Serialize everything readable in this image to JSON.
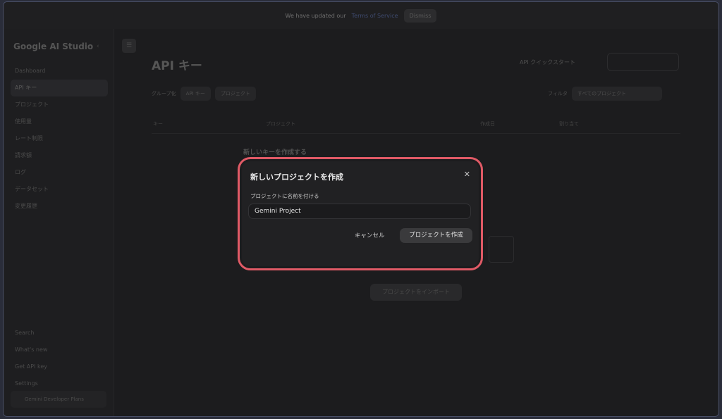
{
  "banner": {
    "text": "We have updated our",
    "link": "Terms of Service",
    "button": "Dismiss"
  },
  "sidebar": {
    "logo": "Google AI Studio",
    "items": [
      {
        "label": "Dashboard"
      },
      {
        "label": "API キー"
      },
      {
        "label": "プロジェクト"
      },
      {
        "label": "使用量"
      },
      {
        "label": "レート制限"
      },
      {
        "label": "請求額"
      },
      {
        "label": "ログ"
      },
      {
        "label": "データセット"
      },
      {
        "label": "変更履歴"
      }
    ],
    "bottom_items": [
      {
        "label": "Search"
      },
      {
        "label": "What's new"
      },
      {
        "label": "Get API key"
      },
      {
        "label": "Settings"
      }
    ],
    "account": "Gemini Developer Plans"
  },
  "main": {
    "title": "API キー",
    "quickstart": "API クイックスタート",
    "filters": {
      "group_label": "グループ化",
      "chip_active": "API キー",
      "chip_project": "プロジェクト",
      "filter_label": "フィルタ",
      "select_value": "すべてのプロジェクト"
    },
    "table_headers": [
      "キー",
      "プロジェクト",
      "作成日",
      "割り当て"
    ],
    "ghost_card_title": "新しいキーを作成する",
    "import_button": "プロジェクトをインポート"
  },
  "dialog": {
    "title": "新しいプロジェクトを作成",
    "field_label": "プロジェクトに名前を付ける",
    "input_value": "Gemini Project",
    "cancel_label": "キャンセル",
    "create_label": "プロジェクトを作成"
  },
  "colors": {
    "highlight": "#e05a66",
    "dialog_bg": "#212123",
    "page_bg": "#1c1c1e"
  }
}
